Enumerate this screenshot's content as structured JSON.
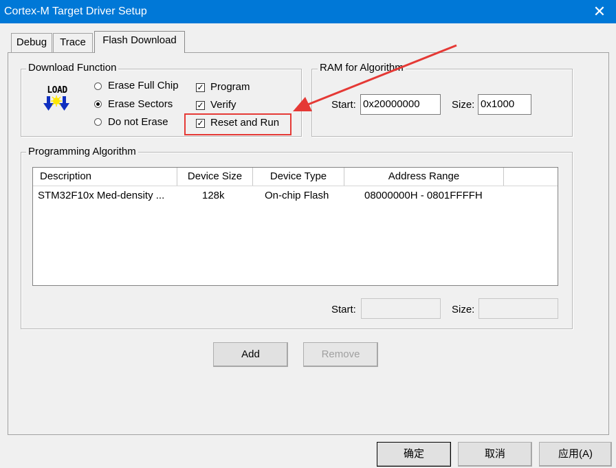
{
  "window": {
    "title": "Cortex-M Target Driver Setup",
    "close_glyph": "✕"
  },
  "tabs": [
    {
      "label": "Debug"
    },
    {
      "label": "Trace"
    },
    {
      "label": "Flash Download"
    }
  ],
  "download_function": {
    "legend": "Download Function",
    "load_icon_text": "LOAD",
    "radios": [
      {
        "label": "Erase Full Chip",
        "checked": false
      },
      {
        "label": "Erase Sectors",
        "checked": true
      },
      {
        "label": "Do not Erase",
        "checked": false
      }
    ],
    "checks": [
      {
        "label": "Program",
        "checked": true
      },
      {
        "label": "Verify",
        "checked": true
      },
      {
        "label": "Reset and Run",
        "checked": true
      }
    ],
    "check_glyph": "✓"
  },
  "ram": {
    "legend": "RAM for Algorithm",
    "start_label": "Start:",
    "start_value": "0x20000000",
    "size_label": "Size:",
    "size_value": "0x1000"
  },
  "programming": {
    "legend": "Programming Algorithm",
    "columns": [
      "Description",
      "Device Size",
      "Device Type",
      "Address Range"
    ],
    "rows": [
      {
        "description": "STM32F10x Med-density ...",
        "size": "128k",
        "type": "On-chip Flash",
        "range": "08000000H - 0801FFFFH"
      }
    ],
    "start_label": "Start:",
    "size_label": "Size:"
  },
  "buttons": {
    "add": "Add",
    "remove": "Remove"
  },
  "footer": {
    "ok": "确定",
    "cancel": "取消",
    "apply": "应用(A)"
  },
  "annotation": {
    "color": "#e53935"
  }
}
